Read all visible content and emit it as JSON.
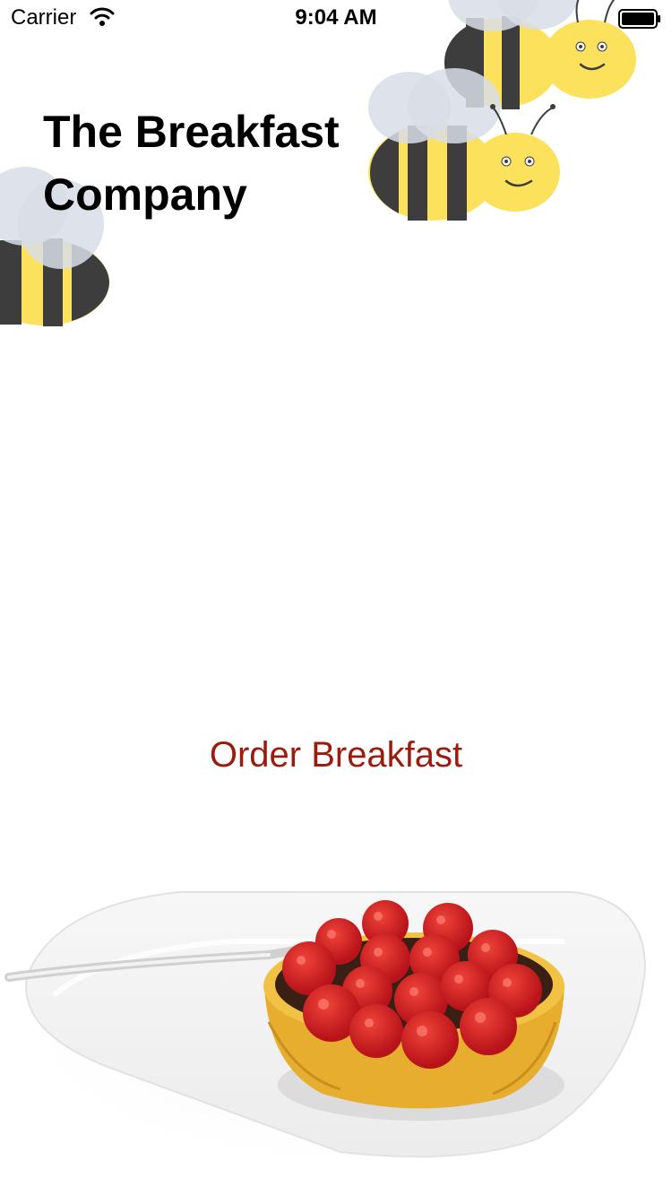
{
  "status_bar": {
    "carrier": "Carrier",
    "time": "9:04 AM",
    "wifi_icon": "wifi-icon",
    "battery_icon": "battery-full-icon"
  },
  "app": {
    "title": "The Breakfast Company",
    "decorations": [
      "bee-icon",
      "bee-icon",
      "bee-icon"
    ]
  },
  "main": {
    "order_button_label": "Order Breakfast"
  },
  "hero": {
    "image": "raspberry-tart-photo"
  },
  "colors": {
    "accent": "#9b1c0e",
    "bee_yellow": "#fbe15c",
    "bee_stripe": "#3d3d3d",
    "bee_wing": "#d8dde6"
  }
}
